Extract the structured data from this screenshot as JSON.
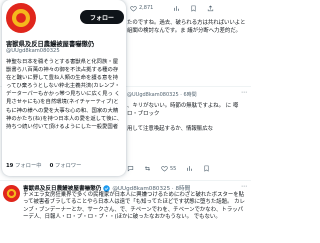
{
  "background_posts": {
    "stats_top": {
      "replies": "",
      "reposts": "",
      "likes": "2,871",
      "views": ""
    },
    "post1": {
      "text": "たのですね。過去、破られる方は共ればいいよと組閣の検討なんです。ま 議が分断へ力差的だ。"
    },
    "post2": {
      "meta": "@UUgd8kam080325 · 6時間",
      "text": "、キリがないい。時節の無駄ですよね。 に 噂ロ・ブロック",
      "text2": "用して注意喚起するか、情報賑広な",
      "stats": {
        "replies": "",
        "reposts": "",
        "likes": "55",
        "views": ""
      }
    }
  },
  "bottom_post": {
    "name": "害獣県及反日農鰻被屋書嚇懲仍",
    "handle": "@UUgd8kam080325 · 8時間",
    "body": "チメエラ女房狂乗界で多くの民権家が日本人に興嫌つけるためにわざと破れたボスターを貼って被害者ブラしてることやら日本人は遠で「も知ってたほどです状態に堕ちた話題。 カレンブ・ブンデーナーとか、サークさん、で、チペーンでわを、チベーンでかなわ、トラッパーデ人、日報人・ロ・プ・ロ・プ・・(ほかに破ったなおかもうない。 でもない。"
  },
  "hover_card": {
    "follow_label": "フォロー",
    "display_name": "害獣県及反日農鰻被屋書嚇懲仍",
    "handle": "@UUgd8kam080325",
    "bio": "神聖な日本を穢そうとする害獣県と化同族・屋獣書ら八百萬の神々の御を不法占拠する種の存在と醜いに野して豊ね人類の生命を護る意を持ってひ棄ろうとしない粋北主義共済(カレンブ・データーパーもかかっ帯つ見ちいに広く見っ く見させゃにも)を自然環境(ネイチャーティブ)ともに神の様への愛を大事な心の和、国家の大精神のかたち(ね)を持つ日本人の愛を返して後に、持ちつ続い付いて頂けるようにした一般愛国者",
    "following_count": "19",
    "following_label": "フォロー中",
    "followers_count": "0",
    "followers_label": "フォロワー"
  },
  "colors": {
    "button_bg": "#0f1419",
    "button_text": "#ffffff",
    "secondary_text": "#536471",
    "avatar_red": "#e0261c",
    "avatar_gold": "#f5b81c"
  }
}
